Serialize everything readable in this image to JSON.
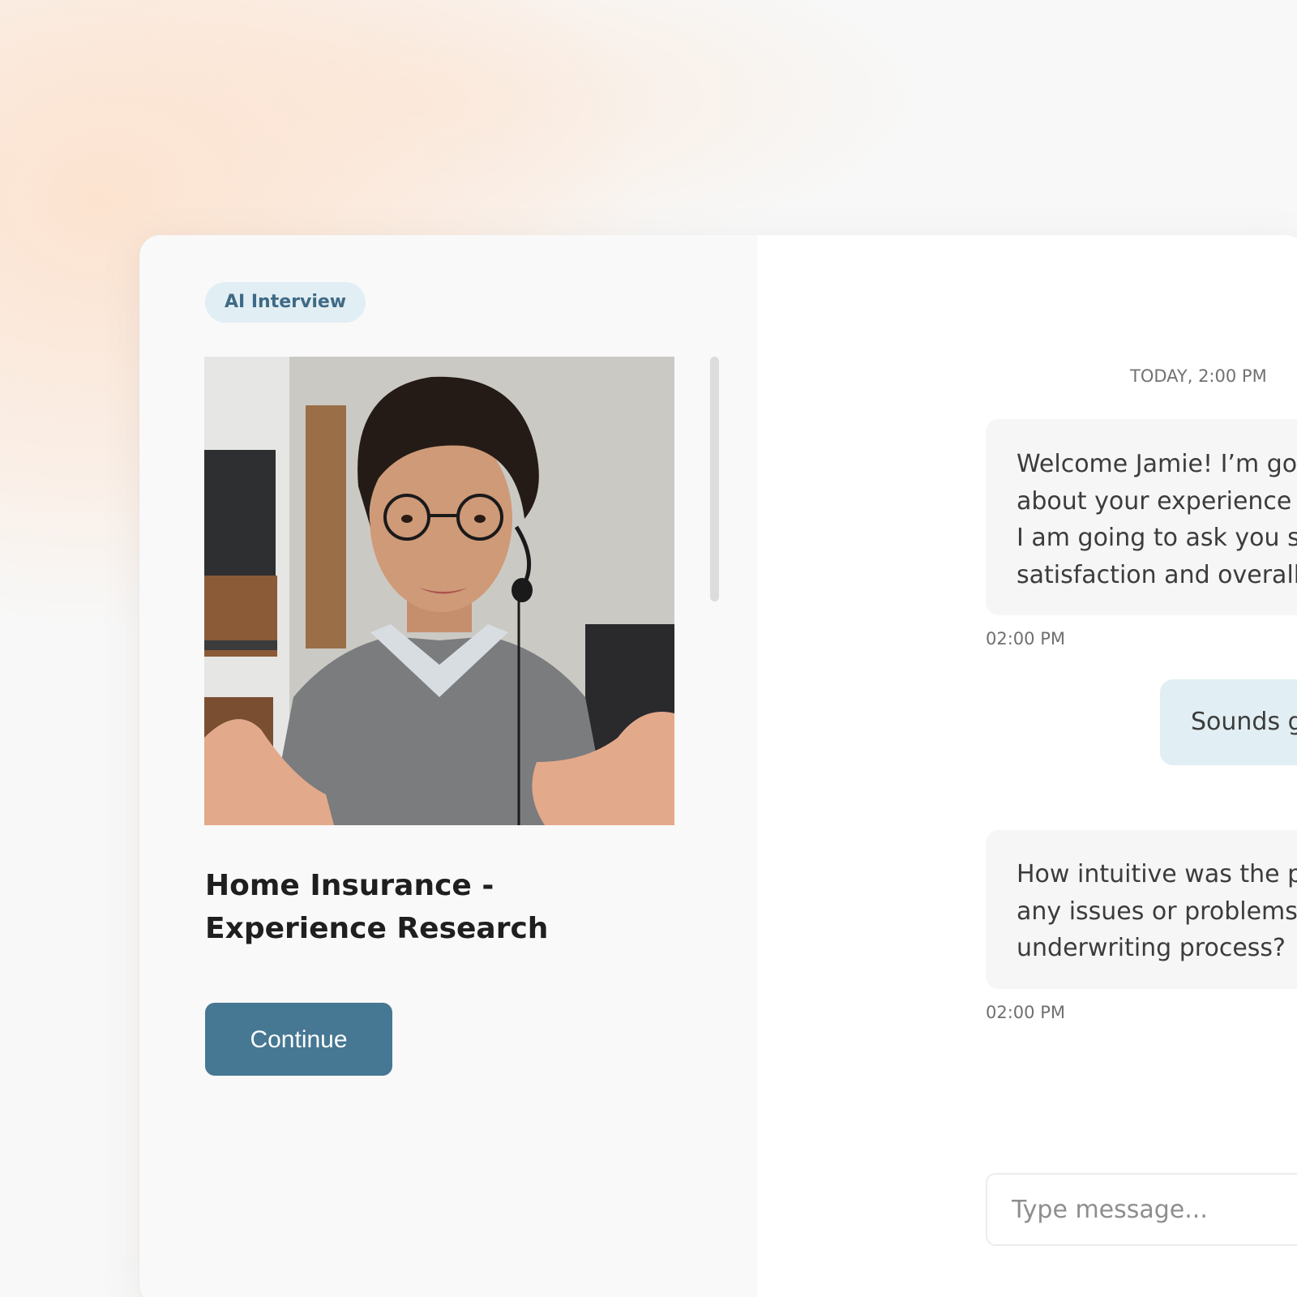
{
  "left_panel": {
    "badge": "AI Interview",
    "title": "Home Insurance -\nExperience Research",
    "continue_label": "Continue"
  },
  "chat": {
    "day_stamp": "TODAY, 2:00 PM",
    "messages": [
      {
        "sender": "ai",
        "lines": [
          "Welcome Jamie! I’m going to inter",
          "about your experience purchasing",
          "I am going to ask you some questi",
          "satisfaction and overall experience"
        ],
        "time": "02:00 PM"
      },
      {
        "sender": "user",
        "lines": [
          "Sounds good! I’m ha"
        ]
      },
      {
        "sender": "ai",
        "lines": [
          "How intuitive was the purchasing e",
          "any issues or problems you encou",
          "underwriting process?"
        ],
        "time": "02:00 PM"
      }
    ],
    "input_placeholder": "Type message..."
  },
  "colors": {
    "accent": "#467793",
    "badge_bg": "#e1eef3",
    "badge_text": "#3f6a86",
    "user_bubble": "#e1eef3",
    "ai_bubble": "#f6f6f6"
  }
}
